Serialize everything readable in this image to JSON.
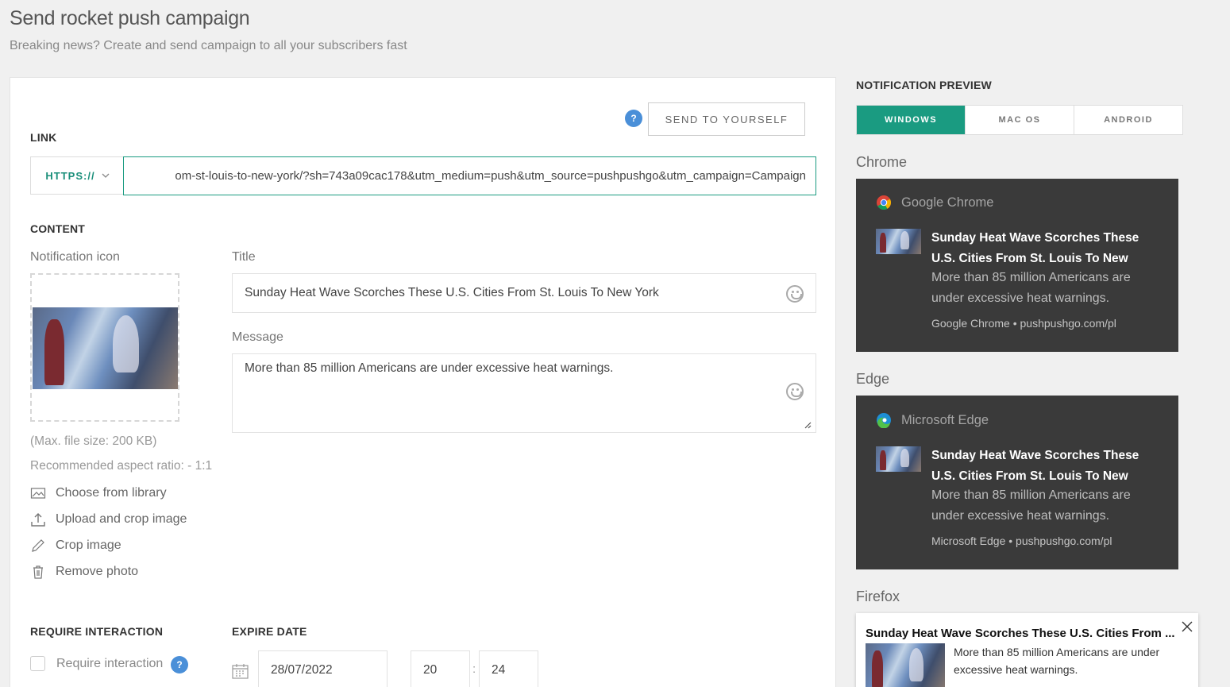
{
  "header": {
    "title": "Send rocket push campaign",
    "subtitle": "Breaking news? Create and send campaign to all your subscribers fast"
  },
  "form": {
    "help_glyph": "?",
    "send_to_yourself": "SEND TO YOURSELF",
    "link": {
      "label": "LINK",
      "protocol": "HTTPS://",
      "url": "om-st-louis-to-new-york/?sh=743a09cac178&utm_medium=push&utm_source=pushpushgo&utm_campaign=Campaign"
    },
    "content": {
      "label": "CONTENT",
      "icon_label": "Notification icon",
      "max_size": "(Max. file size: 200 KB)",
      "aspect": "Recommended aspect ratio: - 1:1",
      "actions": [
        {
          "label": "Choose from library",
          "icon": "image-icon"
        },
        {
          "label": "Upload and crop image",
          "icon": "upload-icon"
        },
        {
          "label": "Crop image",
          "icon": "pencil-icon"
        },
        {
          "label": "Remove photo",
          "icon": "trash-icon"
        }
      ],
      "title_label": "Title",
      "title_value": "Sunday Heat Wave Scorches These U.S. Cities From St. Louis To New York",
      "message_label": "Message",
      "message_value": "More than 85 million Americans are under excessive heat warnings."
    },
    "require_interaction": {
      "label": "REQUIRE INTERACTION",
      "checkbox_label": "Require interaction",
      "checked": false
    },
    "expire": {
      "label": "EXPIRE DATE",
      "date": "28/07/2022",
      "hour": "20",
      "separator": ":",
      "minute": "24"
    }
  },
  "preview": {
    "title": "NOTIFICATION PREVIEW",
    "tabs": [
      {
        "label": "WINDOWS",
        "active": true
      },
      {
        "label": "MAC OS",
        "active": false
      },
      {
        "label": "ANDROID",
        "active": false
      }
    ],
    "chrome": {
      "label": "Chrome",
      "app": "Google Chrome",
      "title": "Sunday Heat Wave Scorches These U.S. Cities From St. Louis To New",
      "message": "More than 85 million Americans are under excessive heat warnings.",
      "footer": "Google Chrome • pushpushgo.com/pl"
    },
    "edge": {
      "label": "Edge",
      "app": "Microsoft Edge",
      "title": "Sunday Heat Wave Scorches These U.S. Cities From St. Louis To New",
      "message": "More than 85 million Americans are under excessive heat warnings.",
      "footer": "Microsoft Edge • pushpushgo.com/pl"
    },
    "firefox": {
      "label": "Firefox",
      "title": "Sunday Heat Wave Scorches These U.S. Cities From ...",
      "message": "More than 85 million Americans are under excessive heat warnings."
    }
  },
  "colors": {
    "accent": "#1a9b81",
    "help": "#4a8fd8",
    "dark_card": "#3a3a3a"
  }
}
